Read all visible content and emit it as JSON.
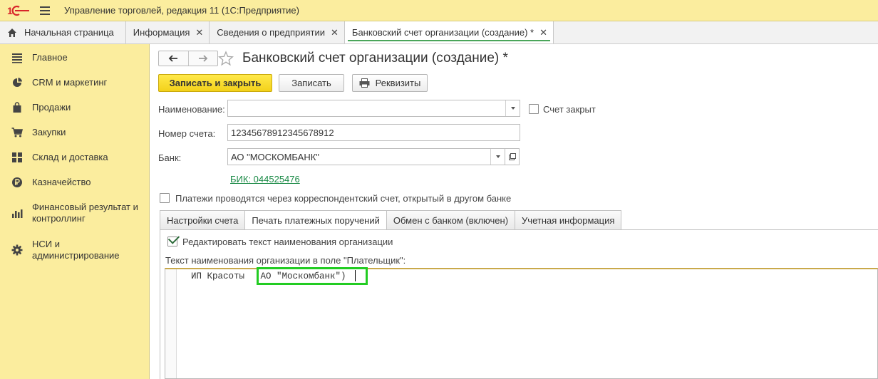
{
  "window": {
    "title": "Управление торговлей, редакция 11  (1С:Предприятие)"
  },
  "tabs": [
    {
      "label": "Начальная страница",
      "icon": "home-icon"
    },
    {
      "label": "Информация",
      "closable": true
    },
    {
      "label": "Сведения о предприятии",
      "closable": true
    },
    {
      "label": "Банковский счет организации (создание) *",
      "closable": true,
      "active": true
    }
  ],
  "sidebar": {
    "items": [
      {
        "label": "Главное",
        "icon": "list-icon"
      },
      {
        "label": "CRM и маркетинг",
        "icon": "pie-chart-icon"
      },
      {
        "label": "Продажи",
        "icon": "shopping-bag-icon"
      },
      {
        "label": "Закупки",
        "icon": "cart-icon"
      },
      {
        "label": "Склад и доставка",
        "icon": "warehouse-grid-icon"
      },
      {
        "label": "Казначейство",
        "icon": "ruble-coin-icon"
      },
      {
        "label": "Финансовый результат и контроллинг",
        "icon": "bar-chart-icon"
      },
      {
        "label": "НСИ и администрирование",
        "icon": "gear-icon"
      }
    ]
  },
  "form": {
    "title": "Банковский счет организации (создание) *",
    "buttons": {
      "save_close": "Записать и закрыть",
      "save": "Записать",
      "details": "Реквизиты"
    },
    "name_label": "Наименование:",
    "name_value": "",
    "closed_label": "Счет закрыт",
    "closed_checked": false,
    "account_label": "Номер счета:",
    "account_value": "12345678912345678912",
    "bank_label": "Банк:",
    "bank_value": "АО \"МОСКОМБАНК\"",
    "bik_link": "БИК: 044525476",
    "corr_label": "Платежи проводятся через корреспондентский счет, открытый в другом банке",
    "corr_checked": false
  },
  "inner_tabs": [
    {
      "label": "Настройки счета"
    },
    {
      "label": "Печать платежных поручений",
      "active": true
    },
    {
      "label": "Обмен с банком (включен)"
    },
    {
      "label": "Учетная информация"
    }
  ],
  "print_tab": {
    "edit_label": "Редактировать текст наименования организации",
    "edit_checked": true,
    "text_label": "Текст наименования организации в поле \"Плательщик\":",
    "text_value": "ИП Красоты  (АО \"Москомбанк\")"
  },
  "colors": {
    "accent_yellow": "#fbed9e",
    "primary_button": "#f3d21a",
    "link_green": "#1a8a46",
    "highlight_green": "#22cc22"
  }
}
